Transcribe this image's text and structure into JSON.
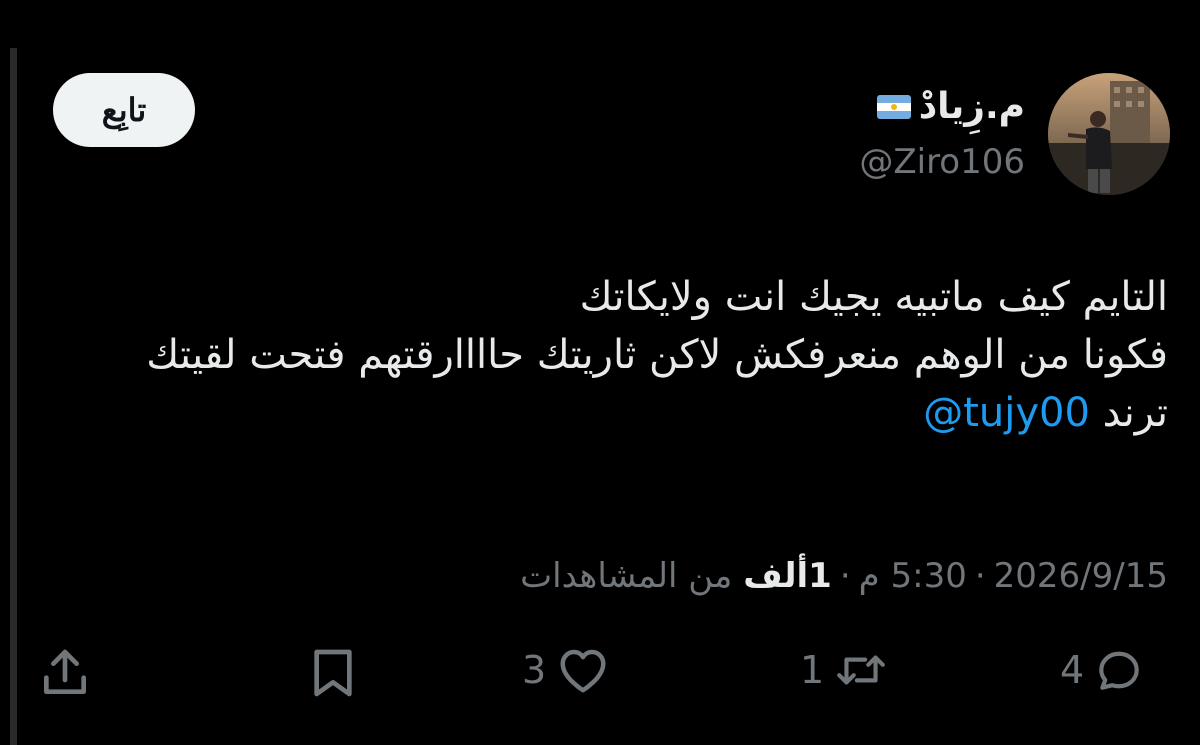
{
  "user": {
    "display_name": "م.زِيادْ",
    "flag_icon": "argentina-flag-icon",
    "handle": "@Ziro106"
  },
  "follow_button": {
    "label": "تابِع"
  },
  "tweet": {
    "lines": [
      "التايم كيف ماتبيه يجيك انت ولايكاتك",
      "فكونا من الوهم منعرفكش لاكن ثاريتك حاااارقتهم فتحت لقيتك",
      "ترند"
    ],
    "mention": "@tujy00"
  },
  "meta": {
    "date": "2026/9/15",
    "sep1": "·",
    "time": "5:30 م",
    "sep2": "·",
    "views_count": "1ألف",
    "views_label": "من المشاهدات"
  },
  "actions": {
    "replies": "4",
    "retweets": "1",
    "likes": "3"
  },
  "colors": {
    "background": "#000000",
    "text": "#e7e9ea",
    "muted": "#71767b",
    "link": "#1d9bf0"
  }
}
